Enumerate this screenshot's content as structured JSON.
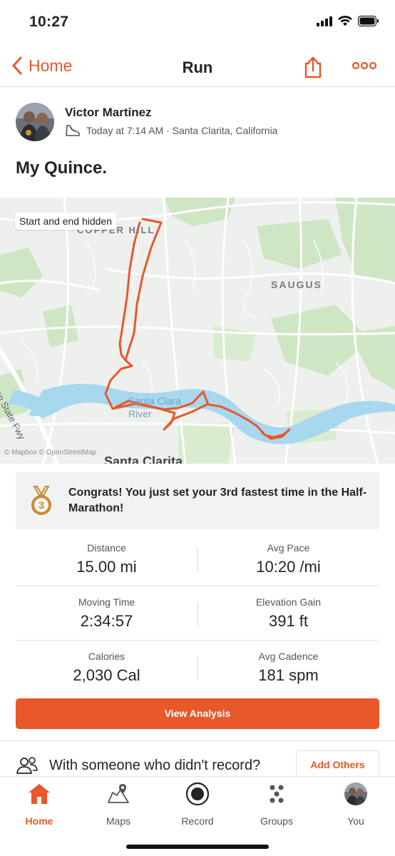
{
  "status_bar": {
    "time": "10:27"
  },
  "nav": {
    "back_label": "Home",
    "title": "Run"
  },
  "athlete": {
    "name": "Victor Martinez",
    "meta": "Today at 7:14 AM · Santa Clarita, California"
  },
  "activity": {
    "title": "My Quince."
  },
  "map": {
    "badge": "Start and end hidden",
    "labels": {
      "copper_hill": "COPPER HILL",
      "saugus": "SAUGUS",
      "river": "Santa Clara River",
      "freeway": "Golden State Fwy",
      "city": "Santa Clarita"
    },
    "attribution": "© Mapbox © OpenStreetMap"
  },
  "achievement": {
    "rank": "3",
    "text": "Congrats! You just set your 3rd fastest time in the Half-Marathon!"
  },
  "stats": [
    {
      "left_label": "Distance",
      "left_value": "15.00 mi",
      "right_label": "Avg Pace",
      "right_value": "10:20 /mi"
    },
    {
      "left_label": "Moving Time",
      "left_value": "2:34:57",
      "right_label": "Elevation Gain",
      "right_value": "391 ft"
    },
    {
      "left_label": "Calories",
      "left_value": "2,030 Cal",
      "right_label": "Avg Cadence",
      "right_value": "181 spm"
    }
  ],
  "analysis_button": "View Analysis",
  "others": {
    "prompt": "With someone who didn't record?",
    "button": "Add Others"
  },
  "tabs": [
    {
      "label": "Home",
      "icon": "home-icon",
      "active": true
    },
    {
      "label": "Maps",
      "icon": "map-icon",
      "active": false
    },
    {
      "label": "Record",
      "icon": "record-icon",
      "active": false
    },
    {
      "label": "Groups",
      "icon": "groups-icon",
      "active": false
    },
    {
      "label": "You",
      "icon": "avatar",
      "active": false
    }
  ],
  "colors": {
    "accent": "#e8582a",
    "text": "#242428",
    "muted": "#54545a",
    "water": "#a8d8f0",
    "park": "#cfe6c4"
  }
}
